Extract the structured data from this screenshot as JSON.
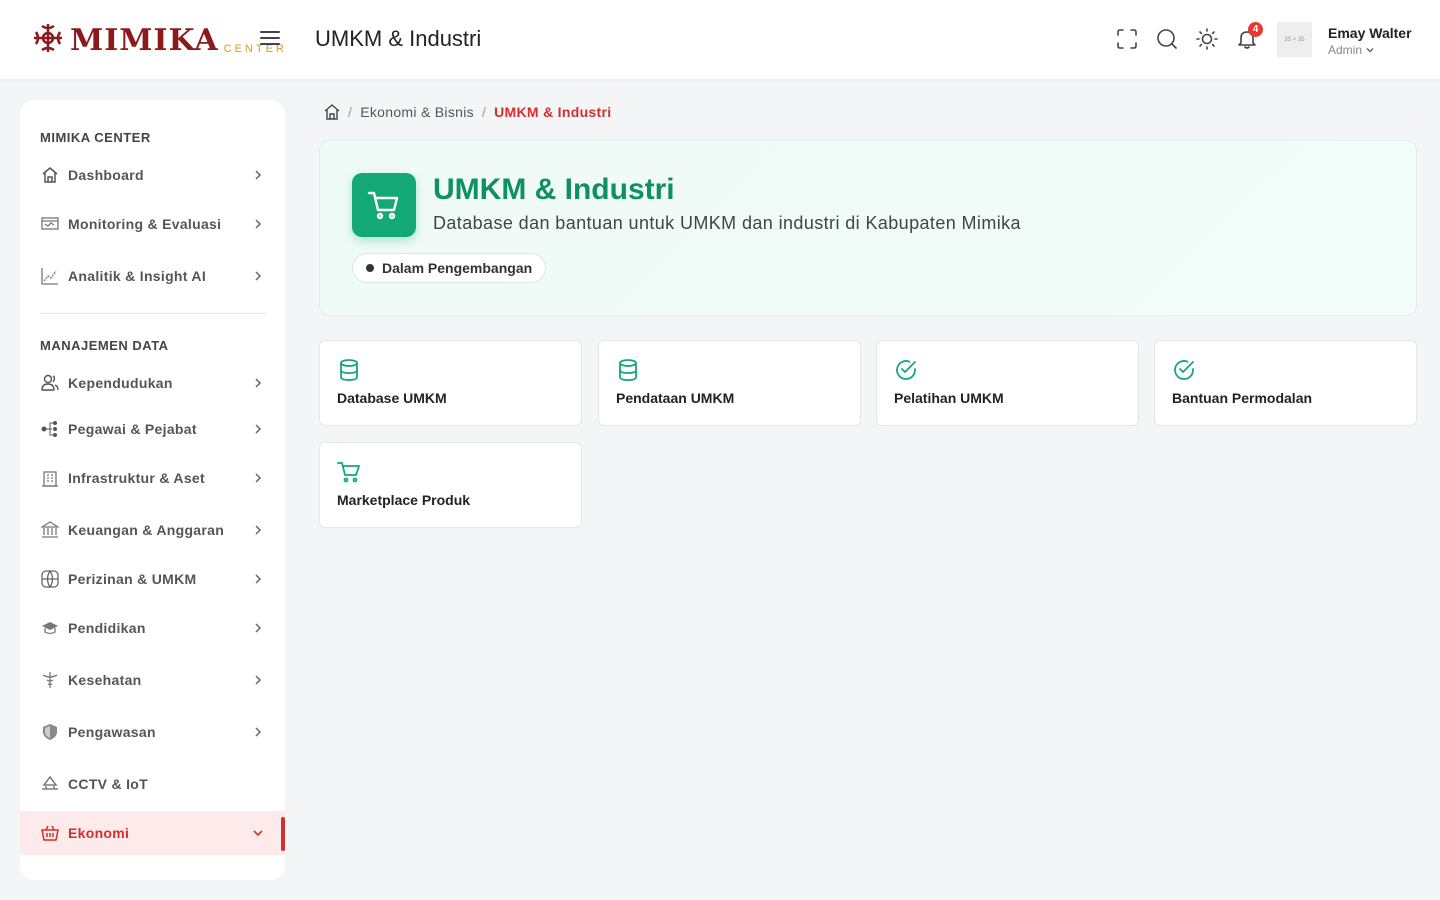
{
  "brand": {
    "name": "MIMIKA",
    "sub": "CENTER",
    "color": "#8b1a1a",
    "sub_color": "#d4a017"
  },
  "header": {
    "title": "UMKM & Industri",
    "notification_count": "4",
    "avatar_placeholder": "35 × 35",
    "user_name": "Emay Walter",
    "user_role": "Admin",
    "icons": [
      "fullscreen-icon",
      "search-icon",
      "theme-toggle-icon",
      "bell-icon"
    ]
  },
  "sidebar": {
    "sections": [
      {
        "title": "MIMIKA CENTER"
      },
      {
        "title": "MANAJEMEN DATA"
      }
    ],
    "items": [
      {
        "label": "Dashboard",
        "icon": "home-icon"
      },
      {
        "label": "Monitoring & Evaluasi",
        "icon": "monitor-icon"
      },
      {
        "label": "Analitik & Insight AI",
        "icon": "chart-icon"
      },
      {
        "label": "Kependudukan",
        "icon": "users-icon"
      },
      {
        "label": "Pegawai & Pejabat",
        "icon": "org-icon"
      },
      {
        "label": "Infrastruktur & Aset",
        "icon": "building-icon"
      },
      {
        "label": "Keuangan & Anggaran",
        "icon": "bank-icon"
      },
      {
        "label": "Perizinan & UMKM",
        "icon": "globe-icon"
      },
      {
        "label": "Pendidikan",
        "icon": "graduation-icon"
      },
      {
        "label": "Kesehatan",
        "icon": "caduceus-icon"
      },
      {
        "label": "Pengawasan",
        "icon": "shield-icon"
      },
      {
        "label": "CCTV & IoT",
        "icon": "cctv-icon"
      },
      {
        "label": "Ekonomi",
        "icon": "basket-icon",
        "active": true
      }
    ],
    "active_color": "#d32f2f"
  },
  "breadcrumb": {
    "items": [
      "Ekonomi & Bisnis",
      "UMKM & Industri"
    ]
  },
  "hero": {
    "title": "UMKM & Industri",
    "description": "Database dan bantuan untuk UMKM dan industri di Kabupaten Mimika",
    "status": "Dalam Pengembangan",
    "accent": "#14a876"
  },
  "cards": [
    {
      "label": "Database UMKM",
      "icon": "database-icon"
    },
    {
      "label": "Pendataan UMKM",
      "icon": "database-icon"
    },
    {
      "label": "Pelatihan UMKM",
      "icon": "check-circle-icon"
    },
    {
      "label": "Bantuan Permodalan",
      "icon": "check-circle-icon"
    },
    {
      "label": "Marketplace Produk",
      "icon": "cart-icon"
    }
  ]
}
